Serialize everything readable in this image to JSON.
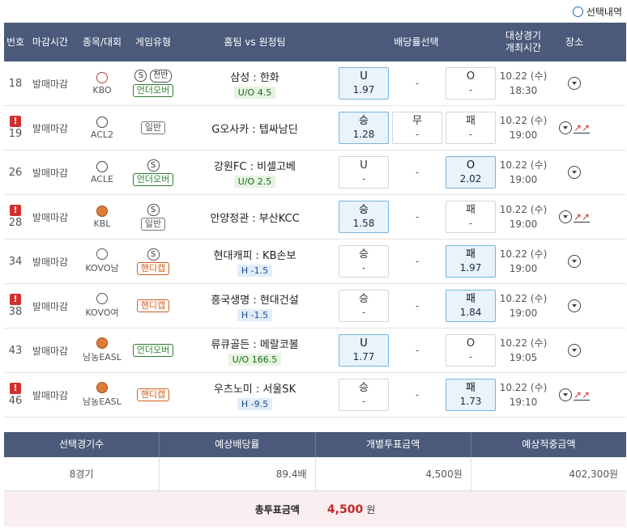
{
  "selection_history_label": "선택내역",
  "headers": {
    "no": "번호",
    "deadline": "마감시간",
    "sport": "종목/대회",
    "game_type": "게임유형",
    "match": "홈팀 vs 원정팀",
    "odds": "배당률선택",
    "time_line1": "대상경기",
    "time_line2": "개최시간",
    "venue": "장소"
  },
  "rows": [
    {
      "no": "18",
      "alert": false,
      "deadline": "발매마감",
      "league": "KBO",
      "sport": "baseball",
      "types": [
        "S",
        "전반",
        "언더오버"
      ],
      "match": "삼성 : 한화",
      "sub": "U/O 4.5",
      "sub_kind": "uo",
      "odds": [
        {
          "label": "U",
          "value": "1.97",
          "selected": true
        },
        {
          "label": "-",
          "value": "",
          "selected": false,
          "dash": true
        },
        {
          "label": "O",
          "value": "-",
          "selected": false
        }
      ],
      "date": "10.22 (수)",
      "time": "18:30",
      "trend": false
    },
    {
      "no": "19",
      "alert": true,
      "deadline": "발매마감",
      "league": "ACL2",
      "sport": "soccer",
      "types": [
        "일반"
      ],
      "match": "G오사카 : 텝싸남딘",
      "sub": "",
      "sub_kind": "",
      "odds": [
        {
          "label": "승",
          "value": "1.28",
          "selected": true
        },
        {
          "label": "무",
          "value": "-",
          "selected": false
        },
        {
          "label": "패",
          "value": "-",
          "selected": false
        }
      ],
      "date": "10.22 (수)",
      "time": "19:00",
      "trend": true
    },
    {
      "no": "26",
      "alert": false,
      "deadline": "발매마감",
      "league": "ACLE",
      "sport": "soccer",
      "types": [
        "S",
        "언더오버"
      ],
      "match": "강원FC : 비셀고베",
      "sub": "U/O 2.5",
      "sub_kind": "uo",
      "odds": [
        {
          "label": "U",
          "value": "-",
          "selected": false
        },
        {
          "label": "-",
          "value": "",
          "selected": false,
          "dash": true
        },
        {
          "label": "O",
          "value": "2.02",
          "selected": true
        }
      ],
      "date": "10.22 (수)",
      "time": "19:00",
      "trend": false
    },
    {
      "no": "28",
      "alert": true,
      "deadline": "발매마감",
      "league": "KBL",
      "sport": "basketball",
      "types": [
        "S",
        "일반"
      ],
      "match": "안양정관 : 부산KCC",
      "sub": "",
      "sub_kind": "",
      "odds": [
        {
          "label": "승",
          "value": "1.58",
          "selected": true
        },
        {
          "label": "-",
          "value": "",
          "selected": false,
          "dash": true
        },
        {
          "label": "패",
          "value": "-",
          "selected": false
        }
      ],
      "date": "10.22 (수)",
      "time": "19:00",
      "trend": true
    },
    {
      "no": "34",
      "alert": false,
      "deadline": "발매마감",
      "league": "KOVO남",
      "sport": "volleyball",
      "types": [
        "S",
        "핸디캡"
      ],
      "match": "현대캐피 : KB손보",
      "sub": "H -1.5",
      "sub_kind": "h",
      "odds": [
        {
          "label": "승",
          "value": "-",
          "selected": false
        },
        {
          "label": "-",
          "value": "",
          "selected": false,
          "dash": true
        },
        {
          "label": "패",
          "value": "1.97",
          "selected": true
        }
      ],
      "date": "10.22 (수)",
      "time": "19:00",
      "trend": false
    },
    {
      "no": "38",
      "alert": true,
      "deadline": "발매마감",
      "league": "KOVO여",
      "sport": "volleyball",
      "types": [
        "핸디캡"
      ],
      "match": "흥국생명 : 현대건설",
      "sub": "H -1.5",
      "sub_kind": "h",
      "odds": [
        {
          "label": "승",
          "value": "-",
          "selected": false
        },
        {
          "label": "-",
          "value": "",
          "selected": false,
          "dash": true
        },
        {
          "label": "패",
          "value": "1.84",
          "selected": true
        }
      ],
      "date": "10.22 (수)",
      "time": "19:00",
      "trend": false
    },
    {
      "no": "43",
      "alert": false,
      "deadline": "발매마감",
      "league": "남농EASL",
      "sport": "basketball",
      "types": [
        "언더오버"
      ],
      "match": "류큐골든 : 메랄코볼",
      "sub": "U/O 166.5",
      "sub_kind": "uo",
      "odds": [
        {
          "label": "U",
          "value": "1.77",
          "selected": true
        },
        {
          "label": "-",
          "value": "",
          "selected": false,
          "dash": true
        },
        {
          "label": "O",
          "value": "-",
          "selected": false
        }
      ],
      "date": "10.22 (수)",
      "time": "19:05",
      "trend": false
    },
    {
      "no": "46",
      "alert": true,
      "deadline": "발매마감",
      "league": "남농EASL",
      "sport": "basketball",
      "types": [
        "핸디캡"
      ],
      "match": "우츠노미 : 서울SK",
      "sub": "H -9.5",
      "sub_kind": "h",
      "odds": [
        {
          "label": "승",
          "value": "-",
          "selected": false
        },
        {
          "label": "-",
          "value": "",
          "selected": false,
          "dash": true
        },
        {
          "label": "패",
          "value": "1.73",
          "selected": true
        }
      ],
      "date": "10.22 (수)",
      "time": "19:10",
      "trend": true
    }
  ],
  "summary": {
    "headers": [
      "선택경기수",
      "예상배당률",
      "개별투표금액",
      "예상적중금액"
    ],
    "values": [
      "8경기",
      "89.4배",
      "4,500원",
      "402,300원"
    ],
    "total_label": "총투표금액",
    "total_value": "4,500",
    "total_unit": "원"
  },
  "colors": {
    "header_bg": "#4b5a7a",
    "selected_bg": "#e8f3fb",
    "alert": "#d32f2f",
    "total_bg": "#fbeef0"
  }
}
